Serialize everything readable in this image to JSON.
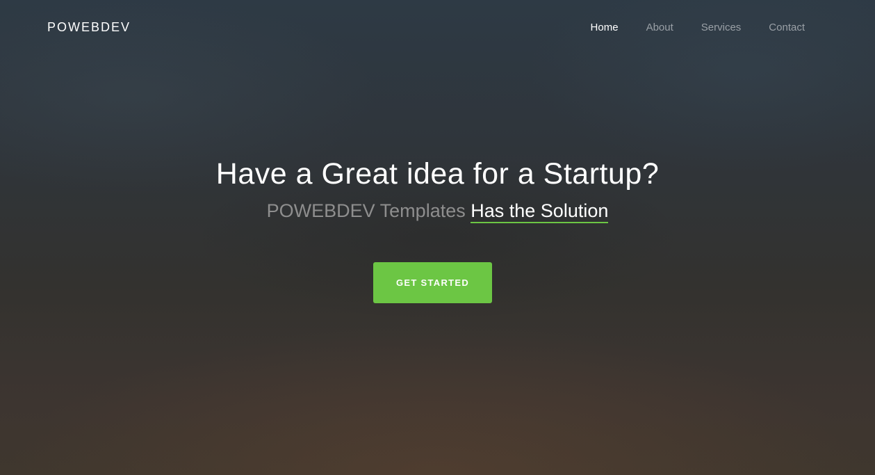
{
  "brand": {
    "name": "POWEBDEV"
  },
  "nav": {
    "items": [
      {
        "label": "Home",
        "active": true
      },
      {
        "label": "About",
        "active": false
      },
      {
        "label": "Services",
        "active": false
      },
      {
        "label": "Contact",
        "active": false
      }
    ]
  },
  "hero": {
    "headline": "Have a Great idea for a Startup?",
    "sub_prefix": "POWEBDEV Templates",
    "sub_highlight": "Has the Solution",
    "cta_label": "GET STARTED"
  },
  "colors": {
    "accent": "#6cc644",
    "nav_inactive": "#9aa0a6",
    "text_primary": "#ffffff",
    "text_muted": "#8e8e8e"
  }
}
